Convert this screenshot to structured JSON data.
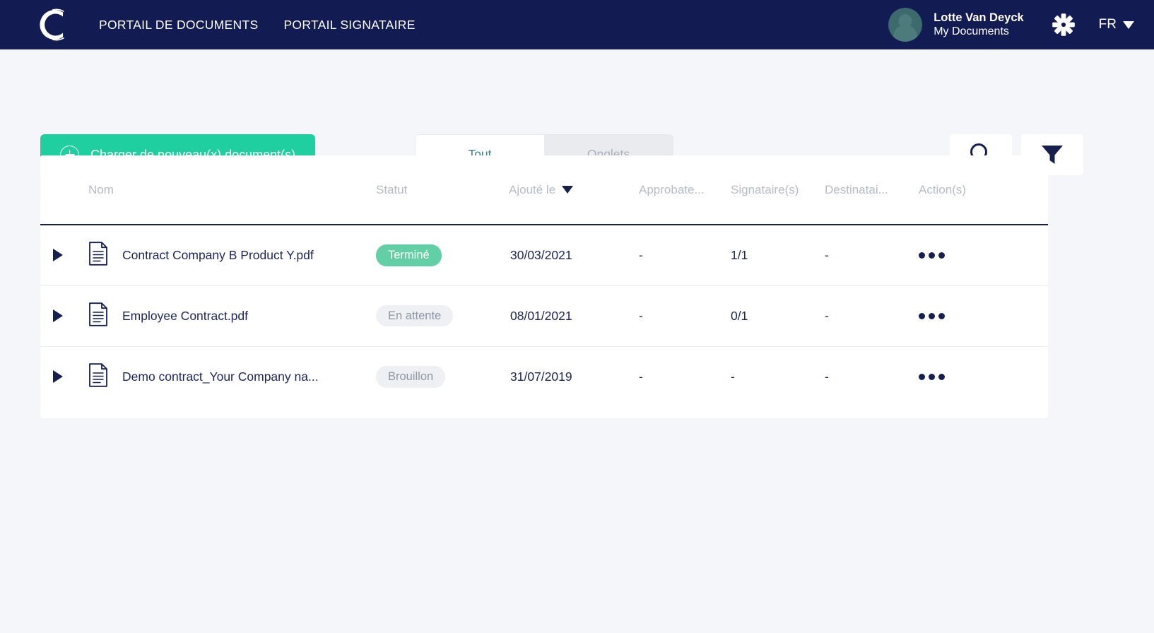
{
  "header": {
    "logo_icon": "c-logo-icon",
    "nav": [
      {
        "label": "PORTAIL DE DOCUMENTS"
      },
      {
        "label": "PORTAIL SIGNATAIRE"
      }
    ],
    "user": {
      "name": "Lotte Van Deyck",
      "subtitle": "My Documents",
      "avatar_icon": "user-avatar-icon"
    },
    "settings_icon": "gear-icon",
    "language": {
      "label": "FR",
      "caret_icon": "chevron-down-icon"
    },
    "colors": {
      "bar_background": "#121b52"
    }
  },
  "toolbar": {
    "upload_label": "Charger de nouveau(x) document(s)",
    "upload_icon": "plus-circle-icon",
    "upload_color": "#20cf9f",
    "tabs": [
      {
        "label": "Tout",
        "active": true
      },
      {
        "label": "Onglets",
        "active": false
      }
    ],
    "search_icon": "search-icon",
    "filter_icon": "filter-icon"
  },
  "table": {
    "columns": [
      {
        "key": "caret",
        "label": ""
      },
      {
        "key": "name",
        "label": "Nom"
      },
      {
        "key": "status",
        "label": "Statut"
      },
      {
        "key": "date",
        "label": "Ajouté le",
        "sorted": true,
        "sort_icon": "sort-desc-icon"
      },
      {
        "key": "appr",
        "label": "Approbate..."
      },
      {
        "key": "sign",
        "label": "Signataire(s)"
      },
      {
        "key": "dest",
        "label": "Destinatai..."
      },
      {
        "key": "act",
        "label": "Action(s)"
      }
    ],
    "rows": [
      {
        "name": "Contract Company B Product Y.pdf",
        "status": "Terminé",
        "status_kind": "done",
        "date": "30/03/2021",
        "approvers": "-",
        "signatories": "1/1",
        "recipients": "-",
        "actions_icon": "ellipsis-icon"
      },
      {
        "name": "Employee Contract.pdf",
        "status": "En attente",
        "status_kind": "neutral",
        "date": "08/01/2021",
        "approvers": "-",
        "signatories": "0/1",
        "recipients": "-",
        "actions_icon": "ellipsis-icon"
      },
      {
        "name": "Demo contract_Your Company na...",
        "status": "Brouillon",
        "status_kind": "neutral",
        "date": "31/07/2019",
        "approvers": "-",
        "signatories": "-",
        "recipients": "-",
        "actions_icon": "ellipsis-icon"
      }
    ],
    "colors": {
      "badge_done_bg": "#63cfa6",
      "badge_neutral_bg": "#eef0f3",
      "header_rule": "#16204f"
    }
  }
}
